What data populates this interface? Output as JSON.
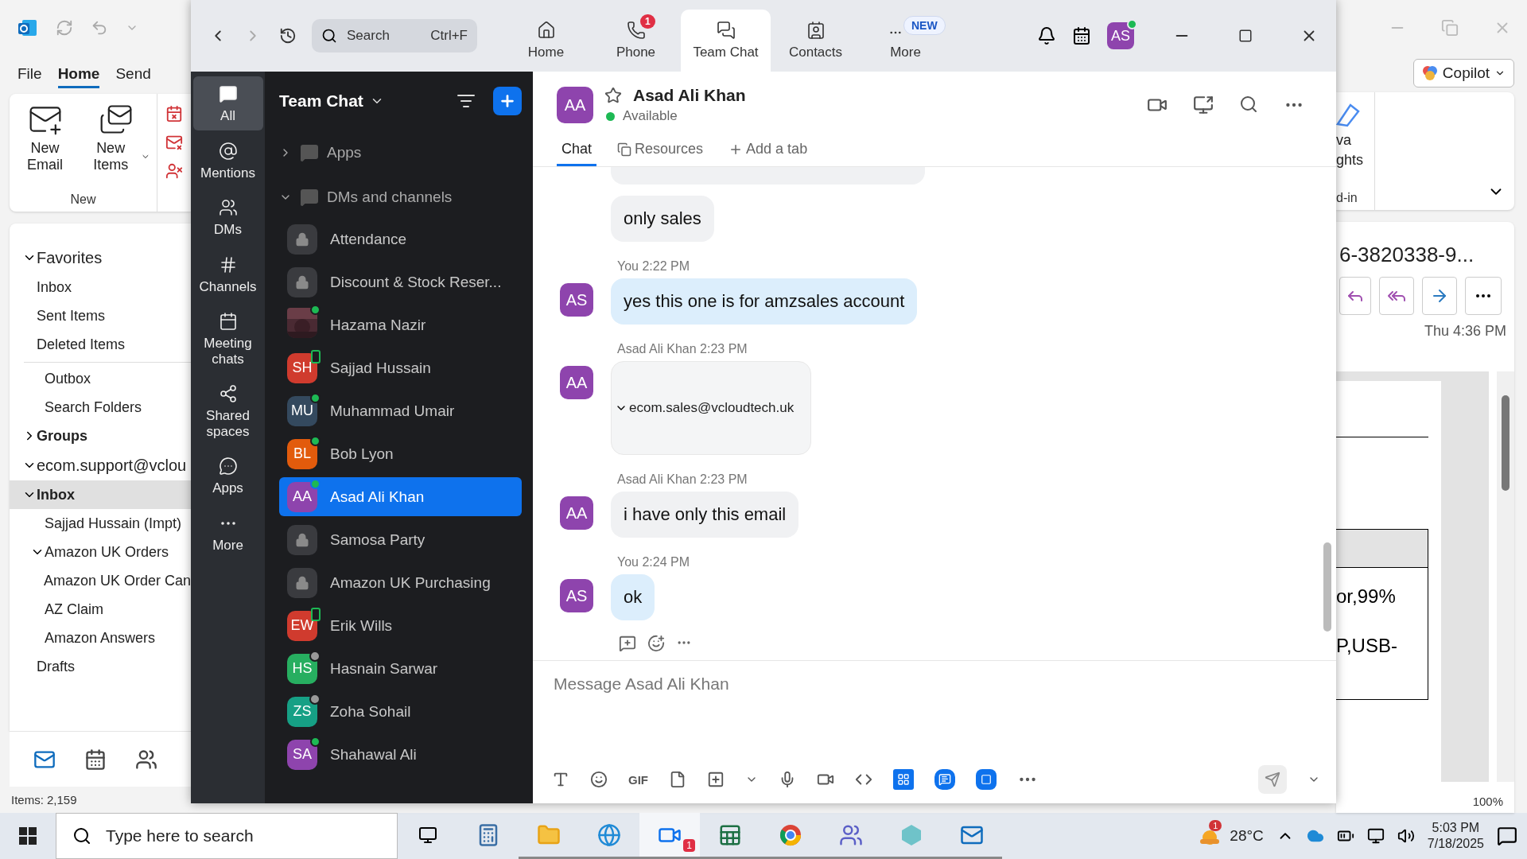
{
  "outlook": {
    "tabs": [
      {
        "label": "File",
        "selected": false
      },
      {
        "label": "Home",
        "selected": true
      },
      {
        "label": "Send",
        "selected": false
      }
    ],
    "ribbon": {
      "buttons": [
        {
          "label": "New Email",
          "dropdown": false
        },
        {
          "label": "New Items",
          "dropdown": true
        }
      ],
      "group": "New",
      "right_fragments": [
        "va",
        "ghts"
      ],
      "right_group": "d-in"
    },
    "copilot": "Copilot",
    "folders": [
      {
        "label": "Favorites",
        "kind": "header",
        "expanded": true,
        "selected": false,
        "children": [
          {
            "label": "Inbox",
            "kind": "folder",
            "selected": false
          },
          {
            "label": "Sent Items",
            "kind": "folder",
            "selected": false
          },
          {
            "label": "Deleted Items",
            "kind": "folder",
            "selected": false
          }
        ]
      },
      {
        "kind": "continued",
        "children": [
          {
            "label": "Outbox",
            "kind": "folder",
            "selected": false
          },
          {
            "label": "Search Folders",
            "kind": "folder",
            "selected": false
          }
        ]
      },
      {
        "label": "Groups",
        "kind": "group",
        "expanded": false,
        "selected": false
      },
      {
        "label": "ecom.support@vclou",
        "kind": "header",
        "expanded": true,
        "selected": false,
        "children": [
          {
            "label": "Inbox",
            "kind": "folder",
            "expanded": true,
            "selected": true,
            "children": [
              {
                "label": "Sajjad Hussain (Impt)",
                "kind": "folder",
                "selected": false
              },
              {
                "label": "Amazon UK Orders",
                "kind": "folder",
                "expanded": true,
                "selected": false,
                "children": [
                  {
                    "label": "Amazon UK Order Can",
                    "kind": "folder",
                    "selected": false
                  }
                ]
              },
              {
                "label": "AZ Claim",
                "kind": "folder",
                "selected": false
              },
              {
                "label": "Amazon Answers",
                "kind": "folder",
                "selected": false
              }
            ]
          },
          {
            "label": "Drafts",
            "kind": "folder",
            "selected": false
          }
        ]
      }
    ],
    "status": "Items: 2,159",
    "reading": {
      "subject": "6-3820338-9...",
      "date": "Thu 4:36 PM",
      "doc_lines": [
        "or,99%",
        "P,USB-"
      ],
      "zoom": "100%"
    }
  },
  "zoom": {
    "search": {
      "placeholder": "Search",
      "shortcut": "Ctrl+F"
    },
    "top_tabs": [
      {
        "label": "Home",
        "selected": false
      },
      {
        "label": "Phone",
        "selected": false,
        "badge": "1"
      },
      {
        "label": "Team Chat",
        "selected": true
      },
      {
        "label": "Contacts",
        "selected": false
      },
      {
        "label": "More",
        "selected": false,
        "badge": "NEW"
      }
    ],
    "user": {
      "initials": "AS",
      "color": "#8e44ad",
      "status": {
        "kind": "online"
      }
    },
    "rail": [
      {
        "label": "All",
        "selected": true
      },
      {
        "label": "Mentions",
        "selected": false
      },
      {
        "label": "DMs",
        "selected": false
      },
      {
        "label": "Channels",
        "selected": false
      },
      {
        "label": "Meeting chats",
        "selected": false
      },
      {
        "label": "Shared spaces",
        "selected": false
      },
      {
        "label": "Apps",
        "selected": false
      },
      {
        "label": "More",
        "selected": false
      }
    ],
    "list": {
      "title": "Team Chat",
      "sections": [
        {
          "label": "Apps",
          "expanded": false
        },
        {
          "label": "DMs and channels",
          "expanded": true,
          "children": [
            {
              "name": "Attendance",
              "kind": "channel",
              "selected": false
            },
            {
              "name": "Discount & Stock Reser...",
              "kind": "channel",
              "selected": false
            },
            {
              "name": "Hazama Nazir",
              "status": {
                "kind": "online"
              },
              "selected": false
            },
            {
              "name": "Sajjad Hussain",
              "kind": "person",
              "initials": "SH",
              "color": "#d03b2e",
              "status": {
                "kind": "mobile"
              },
              "selected": false
            },
            {
              "name": "Muhammad Umair",
              "kind": "person",
              "initials": "MU",
              "color": "#34495e",
              "status": {
                "kind": "online"
              },
              "selected": false
            },
            {
              "name": "Bob Lyon",
              "kind": "person",
              "initials": "BL",
              "color": "#e25b0c",
              "status": {
                "kind": "online"
              },
              "selected": false
            },
            {
              "name": "Asad Ali Khan",
              "kind": "person",
              "initials": "AA",
              "color": "#8e44ad",
              "status": {
                "kind": "online"
              },
              "selected": true
            },
            {
              "name": "Samosa Party",
              "kind": "channel",
              "selected": false
            },
            {
              "name": "Amazon UK Purchasing",
              "kind": "channel",
              "selected": false
            },
            {
              "name": "Erik Wills",
              "kind": "person",
              "initials": "EW",
              "color": "#d03b2e",
              "status": {
                "kind": "mobile"
              },
              "selected": false
            },
            {
              "name": "Hasnain Sarwar",
              "kind": "person",
              "initials": "HS",
              "color": "#27ae60",
              "status": {
                "kind": "away"
              },
              "selected": false
            },
            {
              "name": "Zoha Sohail",
              "kind": "person",
              "initials": "ZS",
              "color": "#16a085",
              "status": {
                "kind": "away"
              },
              "selected": false
            },
            {
              "name": "Shahawal Ali",
              "kind": "person",
              "initials": "SA",
              "color": "#8e44ad",
              "status": {
                "kind": "online"
              },
              "selected": false
            }
          ]
        }
      ]
    },
    "chat": {
      "name": "Asad Ali Khan",
      "initials": "AA",
      "color": "#8e44ad",
      "presence": "Available",
      "favorite": false,
      "tabs": [
        {
          "label": "Chat",
          "selected": true
        },
        {
          "label": "Resources",
          "selected": false
        },
        {
          "label": "Add a tab",
          "selected": false
        }
      ],
      "messages": [
        {
          "kind": "text",
          "mine": false,
          "text": "only sales"
        },
        {
          "kind": "text",
          "mine": true,
          "sender": "You",
          "time": "2:22 PM",
          "initials": "AS",
          "color": "#8e44ad",
          "text": "yes this one is for amzsales account"
        },
        {
          "kind": "email",
          "mine": false,
          "sender": "Asad Ali Khan",
          "time": "2:23 PM",
          "initials": "AA",
          "color": "#8e44ad",
          "text": "ecom.sales@vcloudtech.uk"
        },
        {
          "kind": "text",
          "mine": false,
          "sender": "Asad Ali Khan",
          "time": "2:23 PM",
          "initials": "AA",
          "color": "#8e44ad",
          "text": "i have only this email"
        },
        {
          "kind": "text",
          "mine": true,
          "sender": "You",
          "time": "2:24 PM",
          "initials": "AS",
          "color": "#8e44ad",
          "text": "ok"
        }
      ],
      "composer": {
        "placeholder": "Message Asad Ali Khan",
        "gif": "GIF"
      }
    }
  },
  "taskbar": {
    "search": {
      "placeholder": "Type here to search"
    },
    "zoom_badge": "1",
    "weather": {
      "temp": "28°C",
      "badge": "1"
    },
    "time": "5:03 PM",
    "date": "7/18/2025"
  }
}
